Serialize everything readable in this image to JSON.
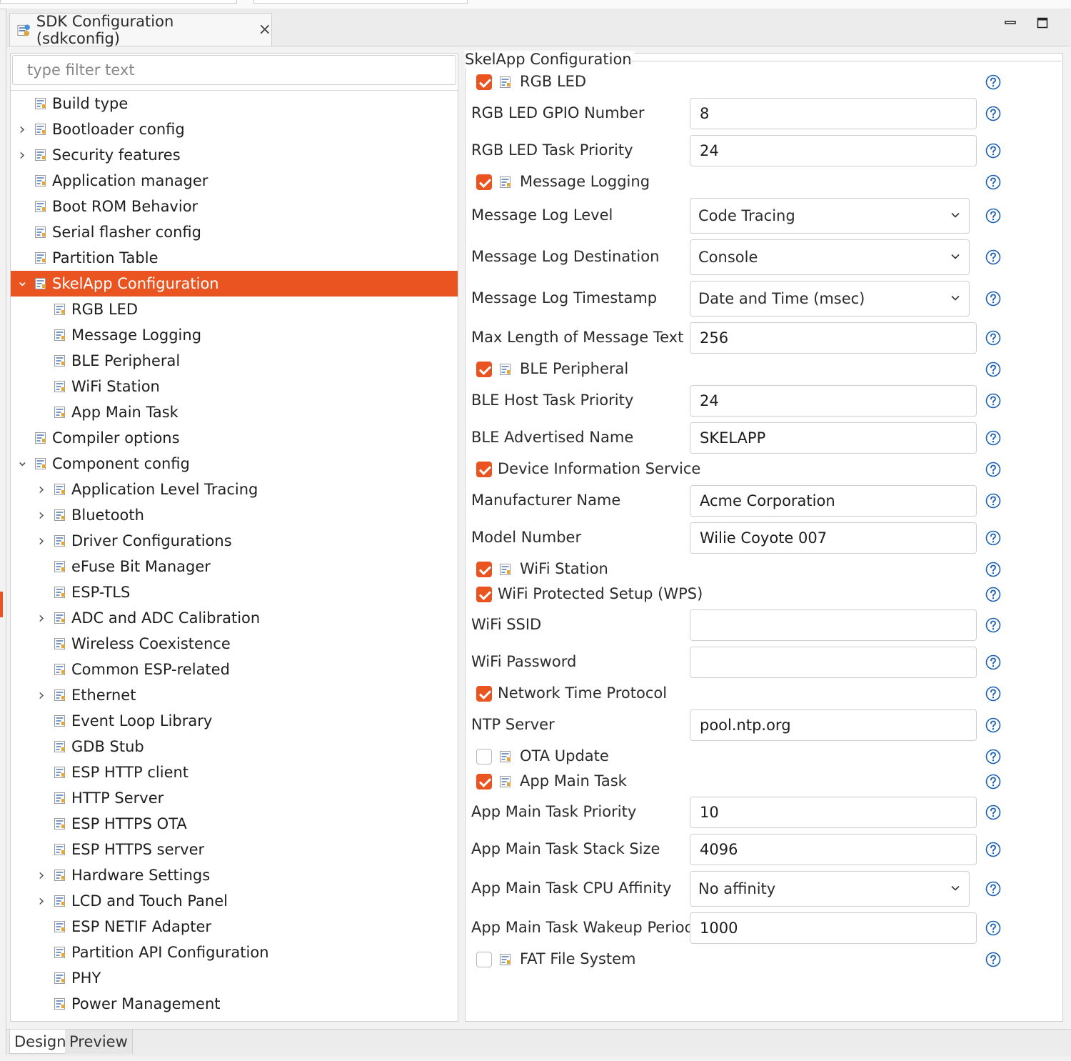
{
  "editor_tab": {
    "title": "SDK Configuration (sdkconfig)",
    "close": "×"
  },
  "window_controls": {
    "minimize": "▭",
    "maximize": "☐"
  },
  "filter": {
    "placeholder": "type filter text"
  },
  "tree": [
    {
      "label": "Build type",
      "expander": ""
    },
    {
      "label": "Bootloader config",
      "expander": "collapsed"
    },
    {
      "label": "Security features",
      "expander": "collapsed"
    },
    {
      "label": "Application manager",
      "expander": ""
    },
    {
      "label": "Boot ROM Behavior",
      "expander": ""
    },
    {
      "label": "Serial flasher config",
      "expander": ""
    },
    {
      "label": "Partition Table",
      "expander": ""
    },
    {
      "label": "SkelApp Configuration",
      "expander": "expanded",
      "selected": true
    },
    {
      "label": "RGB LED",
      "expander": ""
    },
    {
      "label": "Message Logging",
      "expander": ""
    },
    {
      "label": "BLE Peripheral",
      "expander": ""
    },
    {
      "label": "WiFi Station",
      "expander": ""
    },
    {
      "label": "App Main Task",
      "expander": ""
    },
    {
      "label": "Compiler options",
      "expander": ""
    },
    {
      "label": "Component config",
      "expander": "expanded"
    },
    {
      "label": "Application Level Tracing",
      "expander": "collapsed"
    },
    {
      "label": "Bluetooth",
      "expander": "collapsed"
    },
    {
      "label": "Driver Configurations",
      "expander": "collapsed"
    },
    {
      "label": "eFuse Bit Manager",
      "expander": ""
    },
    {
      "label": "ESP-TLS",
      "expander": ""
    },
    {
      "label": "ADC and ADC Calibration",
      "expander": "collapsed"
    },
    {
      "label": "Wireless Coexistence",
      "expander": ""
    },
    {
      "label": "Common ESP-related",
      "expander": ""
    },
    {
      "label": "Ethernet",
      "expander": "collapsed"
    },
    {
      "label": "Event Loop Library",
      "expander": ""
    },
    {
      "label": "GDB Stub",
      "expander": ""
    },
    {
      "label": "ESP HTTP client",
      "expander": ""
    },
    {
      "label": "HTTP Server",
      "expander": ""
    },
    {
      "label": "ESP HTTPS OTA",
      "expander": ""
    },
    {
      "label": "ESP HTTPS server",
      "expander": ""
    },
    {
      "label": "Hardware Settings",
      "expander": "collapsed"
    },
    {
      "label": "LCD and Touch Panel",
      "expander": "collapsed"
    },
    {
      "label": "ESP NETIF Adapter",
      "expander": ""
    },
    {
      "label": "Partition API Configuration",
      "expander": ""
    },
    {
      "label": "PHY",
      "expander": ""
    },
    {
      "label": "Power Management",
      "expander": ""
    }
  ],
  "section_title": "SkelApp Configuration",
  "form": [
    {
      "type": "checkbox",
      "label": "RGB LED",
      "checked": true,
      "icon": true
    },
    {
      "type": "text",
      "label": "RGB LED GPIO Number",
      "value": "8"
    },
    {
      "type": "text",
      "label": "RGB LED Task Priority",
      "value": "24"
    },
    {
      "type": "checkbox",
      "label": "Message Logging",
      "checked": true,
      "icon": true
    },
    {
      "type": "combo",
      "label": "Message Log Level",
      "value": "Code Tracing"
    },
    {
      "type": "combo",
      "label": "Message Log Destination",
      "value": "Console"
    },
    {
      "type": "combo",
      "label": "Message Log Timestamp",
      "value": "Date and Time (msec)"
    },
    {
      "type": "text",
      "label": "Max Length of Message Text",
      "value": "256"
    },
    {
      "type": "checkbox",
      "label": "BLE Peripheral",
      "checked": true,
      "icon": true
    },
    {
      "type": "text",
      "label": "BLE Host Task Priority",
      "value": "24"
    },
    {
      "type": "text",
      "label": "BLE Advertised Name",
      "value": "SKELAPP"
    },
    {
      "type": "checkbox",
      "label": "Device Information Service",
      "checked": true,
      "icon": false
    },
    {
      "type": "text",
      "label": "Manufacturer Name",
      "value": "Acme Corporation"
    },
    {
      "type": "text",
      "label": "Model Number",
      "value": "Wilie Coyote 007"
    },
    {
      "type": "checkbox",
      "label": "WiFi Station",
      "checked": true,
      "icon": true
    },
    {
      "type": "checkbox",
      "label": "WiFi Protected Setup (WPS)",
      "checked": true,
      "icon": false
    },
    {
      "type": "text",
      "label": "WiFi SSID",
      "value": ""
    },
    {
      "type": "text",
      "label": "WiFi Password",
      "value": ""
    },
    {
      "type": "checkbox",
      "label": "Network Time Protocol",
      "checked": true,
      "icon": false
    },
    {
      "type": "text",
      "label": "NTP Server",
      "value": "pool.ntp.org"
    },
    {
      "type": "checkbox",
      "label": "OTA Update",
      "checked": false,
      "icon": true
    },
    {
      "type": "checkbox",
      "label": "App Main Task",
      "checked": true,
      "icon": true
    },
    {
      "type": "text",
      "label": "App Main Task Priority",
      "value": "10"
    },
    {
      "type": "text",
      "label": "App Main Task Stack Size",
      "value": "4096"
    },
    {
      "type": "combo",
      "label": "App Main Task CPU Affinity",
      "value": "No affinity"
    },
    {
      "type": "text",
      "label": "App Main Task Wakeup Period",
      "value": "1000"
    },
    {
      "type": "checkbox",
      "label": "FAT File System",
      "checked": false,
      "icon": true
    }
  ],
  "bottom_tabs": {
    "design": "Design",
    "preview": "Preview"
  },
  "colors": {
    "accent": "#e95420",
    "border": "#cfcfcf",
    "help_blue": "#1a5fb4"
  },
  "icons": {
    "tree_item": "config-page-icon",
    "help": "help-icon",
    "dropdown": "chevron-down-icon"
  }
}
